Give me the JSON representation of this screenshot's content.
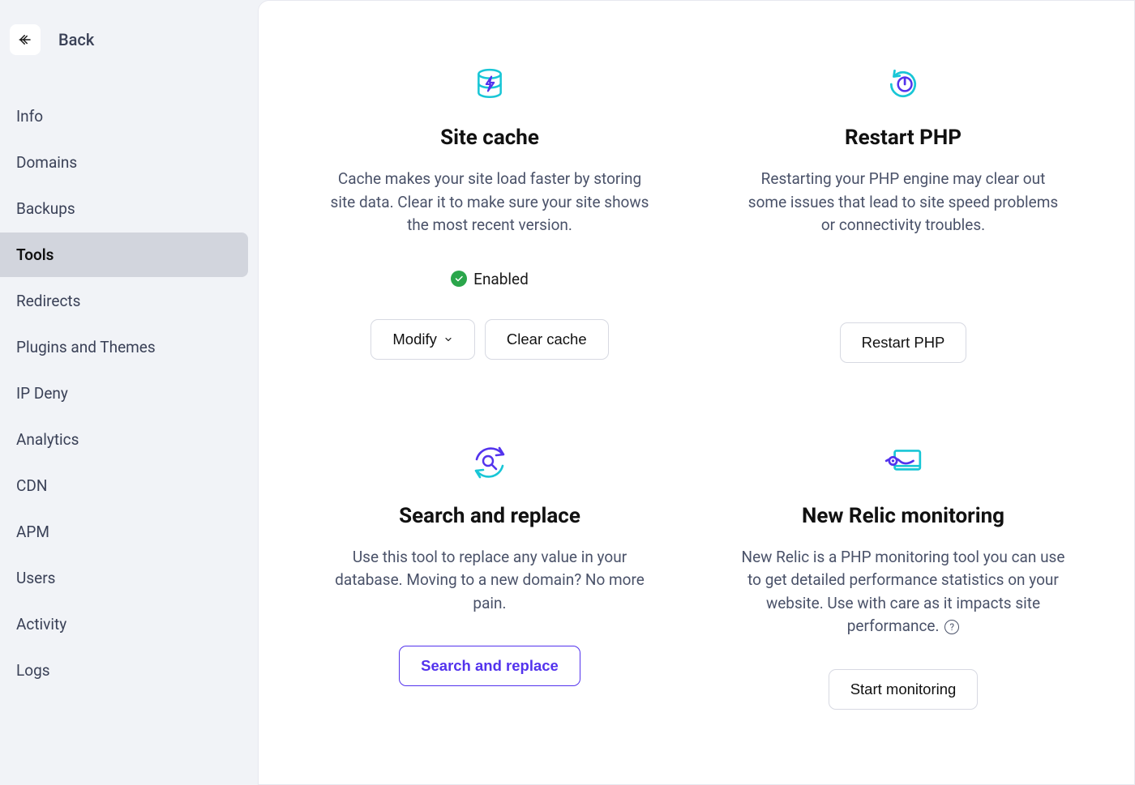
{
  "back_label": "Back",
  "sidebar": {
    "items": [
      {
        "label": "Info"
      },
      {
        "label": "Domains"
      },
      {
        "label": "Backups"
      },
      {
        "label": "Tools",
        "active": true
      },
      {
        "label": "Redirects"
      },
      {
        "label": "Plugins and Themes"
      },
      {
        "label": "IP Deny"
      },
      {
        "label": "Analytics"
      },
      {
        "label": "CDN"
      },
      {
        "label": "APM"
      },
      {
        "label": "Users"
      },
      {
        "label": "Activity"
      },
      {
        "label": "Logs"
      }
    ]
  },
  "cards": {
    "site_cache": {
      "title": "Site cache",
      "desc": "Cache makes your site load faster by storing site data. Clear it to make sure your site shows the most recent version.",
      "status": "Enabled",
      "modify_label": "Modify",
      "clear_label": "Clear cache"
    },
    "restart_php": {
      "title": "Restart PHP",
      "desc": "Restarting your PHP engine may clear out some issues that lead to site speed problems or connectivity troubles.",
      "button": "Restart PHP"
    },
    "search_replace": {
      "title": "Search and replace",
      "desc": "Use this tool to replace any value in your database. Moving to a new domain? No more pain.",
      "button": "Search and replace"
    },
    "new_relic": {
      "title": "New Relic monitoring",
      "desc": "New Relic is a PHP monitoring tool you can use to get detailed performance statistics on your website. Use with care as it impacts site performance.",
      "button": "Start monitoring"
    }
  }
}
